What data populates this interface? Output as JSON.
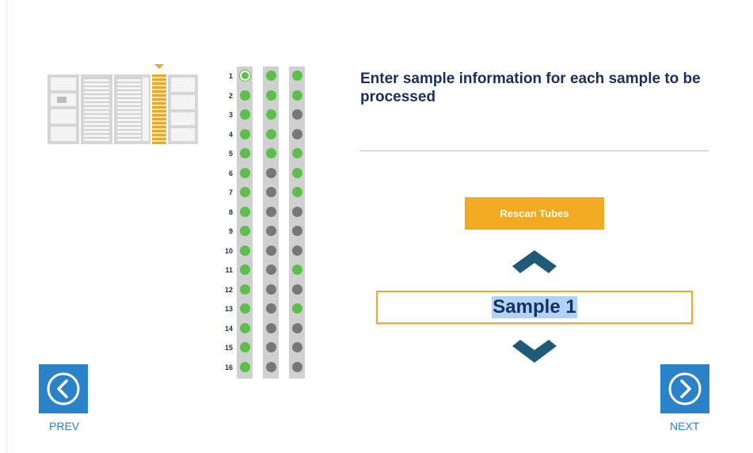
{
  "instruction": "Enter sample information for each sample to be processed",
  "rescan_label": "Rescan Tubes",
  "sample_value": "Sample 1",
  "nav": {
    "prev_label": "PREV",
    "next_label": "NEXT"
  },
  "rack": {
    "rows": [
      "1",
      "2",
      "3",
      "4",
      "5",
      "6",
      "7",
      "8",
      "9",
      "10",
      "11",
      "12",
      "13",
      "14",
      "15",
      "16"
    ],
    "columns": [
      [
        "selected",
        "green",
        "green",
        "green",
        "green",
        "green",
        "green",
        "green",
        "green",
        "green",
        "green",
        "green",
        "green",
        "green",
        "green",
        "green"
      ],
      [
        "green",
        "green",
        "green",
        "green",
        "green",
        "gray",
        "gray",
        "gray",
        "gray",
        "gray",
        "gray",
        "gray",
        "gray",
        "gray",
        "gray",
        "gray"
      ],
      [
        "green",
        "green",
        "gray",
        "gray",
        "green",
        "green",
        "green",
        "gray",
        "gray",
        "gray",
        "green",
        "gray",
        "green",
        "gray",
        "gray",
        "gray"
      ]
    ],
    "selected_row": "1",
    "selected_column": 1
  },
  "colors": {
    "accent_orange": "#f1aa21",
    "navy": "#1a2f5c",
    "chevron": "#1f5a78",
    "nav_blue": "#2a82c9",
    "tube_green": "#5cbf4a",
    "tube_gray": "#777777"
  },
  "icons": {
    "prev": "chevron-left-circle-icon",
    "next": "chevron-right-circle-icon",
    "up": "chevron-up-icon",
    "down": "chevron-down-icon"
  }
}
